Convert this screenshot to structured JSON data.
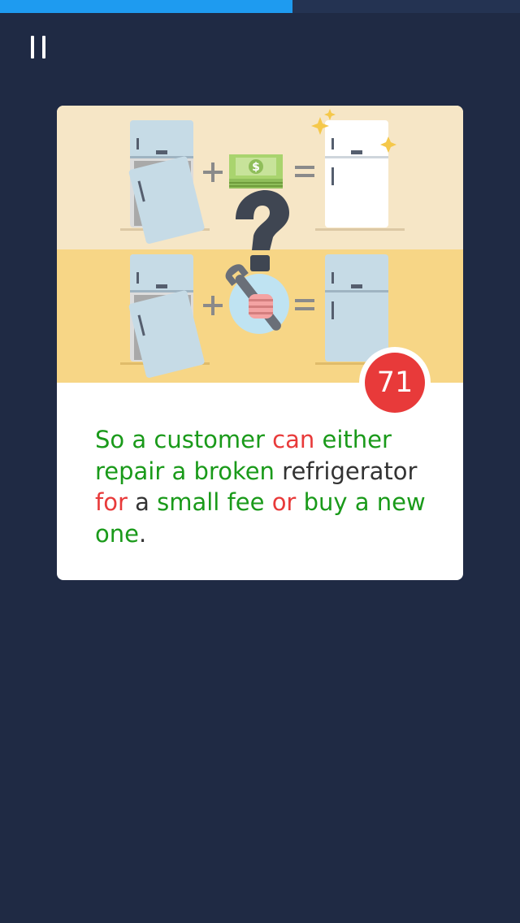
{
  "progress": {
    "fraction": 0.5625,
    "color": "#1e9bf0"
  },
  "pause": {
    "icon": "pause-icon"
  },
  "card": {
    "badge": {
      "number": "71",
      "color": "#e83a3a"
    },
    "illustration": {
      "icons": [
        "broken-fridge-icon",
        "plus-icon",
        "money-icon",
        "equals-icon",
        "new-fridge-icon",
        "sparkle-icon",
        "question-mark-icon",
        "wrench-hand-icon",
        "repaired-fridge-icon"
      ]
    },
    "sentence": {
      "words": [
        {
          "text": "So",
          "status": "known"
        },
        {
          "text": "a",
          "status": "known"
        },
        {
          "text": "customer",
          "status": "known"
        },
        {
          "text": "can",
          "status": "unknown"
        },
        {
          "text": "either",
          "status": "known"
        },
        {
          "text": "repair",
          "status": "known"
        },
        {
          "text": "a",
          "status": "known"
        },
        {
          "text": "broken",
          "status": "known"
        },
        {
          "text": "refrigerator",
          "status": "neutral"
        },
        {
          "text": "for",
          "status": "unknown"
        },
        {
          "text": "a",
          "status": "neutral"
        },
        {
          "text": "small",
          "status": "known"
        },
        {
          "text": "fee",
          "status": "known"
        },
        {
          "text": "or",
          "status": "unknown"
        },
        {
          "text": "buy",
          "status": "known"
        },
        {
          "text": "a",
          "status": "known"
        },
        {
          "text": "new",
          "status": "known"
        },
        {
          "text": "one",
          "status": "known"
        }
      ],
      "end_punctuation": ".",
      "colors": {
        "known": "#1a9a1a",
        "unknown": "#e83a3a",
        "neutral": "#333333"
      }
    }
  }
}
